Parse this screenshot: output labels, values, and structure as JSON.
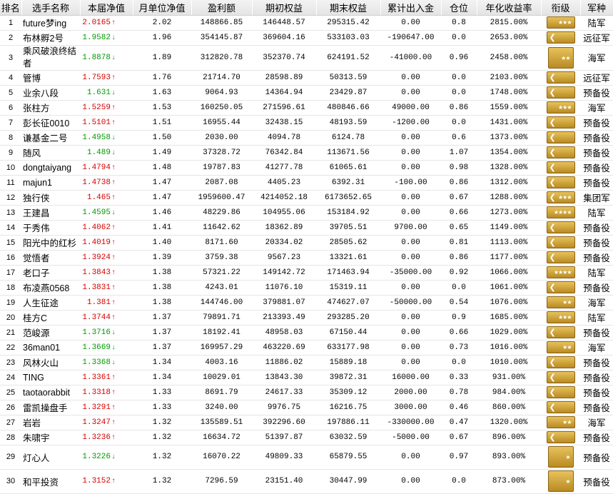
{
  "headers": [
    "排名",
    "选手名称",
    "本届净值",
    "月单位净值",
    "盈利额",
    "期初权益",
    "期末权益",
    "累计出入金",
    "仓位",
    "年化收益率",
    "衔级",
    "军种"
  ],
  "rows": [
    {
      "rank": "1",
      "name": "future梦ing",
      "nav": "2.0165",
      "dir": "up",
      "unit": "2.02",
      "profit": "148866.85",
      "begin": "146448.57",
      "end": "295315.42",
      "flow": "0.00",
      "pos": "0.8",
      "annual": "2815.00%",
      "badge": "stars3",
      "arm": "陆军"
    },
    {
      "rank": "2",
      "name": "布林孵2号",
      "nav": "1.9582",
      "dir": "down",
      "unit": "1.96",
      "profit": "354145.87",
      "begin": "369604.16",
      "end": "533103.03",
      "flow": "-190647.00",
      "pos": "0.0",
      "annual": "2653.00%",
      "badge": "chev",
      "arm": "远征军"
    },
    {
      "rank": "3",
      "name": "乘风破浪终结者",
      "nav": "1.8878",
      "dir": "down",
      "unit": "1.89",
      "profit": "312820.78",
      "begin": "352370.74",
      "end": "624191.52",
      "flow": "-41000.00",
      "pos": "0.96",
      "annual": "2458.00%",
      "badge": "tall2",
      "arm": "海军"
    },
    {
      "rank": "4",
      "name": "管博",
      "nav": "1.7593",
      "dir": "up",
      "unit": "1.76",
      "profit": "21714.70",
      "begin": "28598.89",
      "end": "50313.59",
      "flow": "0.00",
      "pos": "0.0",
      "annual": "2103.00%",
      "badge": "chev",
      "arm": "远征军"
    },
    {
      "rank": "5",
      "name": "业余八段",
      "nav": "1.631",
      "dir": "down",
      "unit": "1.63",
      "profit": "9064.93",
      "begin": "14364.94",
      "end": "23429.87",
      "flow": "0.00",
      "pos": "0.0",
      "annual": "1748.00%",
      "badge": "chev",
      "arm": "预备役"
    },
    {
      "rank": "6",
      "name": "张柱方",
      "nav": "1.5259",
      "dir": "up",
      "unit": "1.53",
      "profit": "160250.05",
      "begin": "271596.61",
      "end": "480846.66",
      "flow": "49000.00",
      "pos": "0.86",
      "annual": "1559.00%",
      "badge": "stars3",
      "arm": "海军"
    },
    {
      "rank": "7",
      "name": "彭长征0010",
      "nav": "1.5101",
      "dir": "up",
      "unit": "1.51",
      "profit": "16955.44",
      "begin": "32438.15",
      "end": "48193.59",
      "flow": "-1200.00",
      "pos": "0.0",
      "annual": "1431.00%",
      "badge": "chev",
      "arm": "预备役"
    },
    {
      "rank": "8",
      "name": "谦基金二号",
      "nav": "1.4958",
      "dir": "down",
      "unit": "1.50",
      "profit": "2030.00",
      "begin": "4094.78",
      "end": "6124.78",
      "flow": "0.00",
      "pos": "0.6",
      "annual": "1373.00%",
      "badge": "chev",
      "arm": "预备役"
    },
    {
      "rank": "9",
      "name": "随风",
      "nav": "1.489",
      "dir": "down",
      "unit": "1.49",
      "profit": "37328.72",
      "begin": "76342.84",
      "end": "113671.56",
      "flow": "0.00",
      "pos": "1.07",
      "annual": "1354.00%",
      "badge": "chev",
      "arm": "预备役"
    },
    {
      "rank": "10",
      "name": "dongtaiyang",
      "nav": "1.4794",
      "dir": "up",
      "unit": "1.48",
      "profit": "19787.83",
      "begin": "41277.78",
      "end": "61065.61",
      "flow": "0.00",
      "pos": "0.98",
      "annual": "1328.00%",
      "badge": "chev",
      "arm": "预备役"
    },
    {
      "rank": "11",
      "name": "majun1",
      "nav": "1.4738",
      "dir": "up",
      "unit": "1.47",
      "profit": "2087.08",
      "begin": "4405.23",
      "end": "6392.31",
      "flow": "-100.00",
      "pos": "0.86",
      "annual": "1312.00%",
      "badge": "chev",
      "arm": "预备役"
    },
    {
      "rank": "12",
      "name": "独行侠",
      "nav": "1.465",
      "dir": "up",
      "unit": "1.47",
      "profit": "1959600.47",
      "begin": "4214052.18",
      "end": "6173652.65",
      "flow": "0.00",
      "pos": "0.67",
      "annual": "1288.00%",
      "badge": "chev3",
      "arm": "集团军"
    },
    {
      "rank": "13",
      "name": "王建昌",
      "nav": "1.4595",
      "dir": "down",
      "unit": "1.46",
      "profit": "48229.86",
      "begin": "104955.06",
      "end": "153184.92",
      "flow": "0.00",
      "pos": "0.66",
      "annual": "1273.00%",
      "badge": "stars4",
      "arm": "陆军"
    },
    {
      "rank": "14",
      "name": "于秀伟",
      "nav": "1.4062",
      "dir": "up",
      "unit": "1.41",
      "profit": "11642.62",
      "begin": "18362.89",
      "end": "39705.51",
      "flow": "9700.00",
      "pos": "0.65",
      "annual": "1149.00%",
      "badge": "chev",
      "arm": "预备役"
    },
    {
      "rank": "15",
      "name": "阳光中的红杉",
      "nav": "1.4019",
      "dir": "up",
      "unit": "1.40",
      "profit": "8171.60",
      "begin": "20334.02",
      "end": "28505.62",
      "flow": "0.00",
      "pos": "0.81",
      "annual": "1113.00%",
      "badge": "chev",
      "arm": "预备役"
    },
    {
      "rank": "16",
      "name": "觉悟者",
      "nav": "1.3924",
      "dir": "up",
      "unit": "1.39",
      "profit": "3759.38",
      "begin": "9567.23",
      "end": "13321.61",
      "flow": "0.00",
      "pos": "0.86",
      "annual": "1177.00%",
      "badge": "chev",
      "arm": "预备役"
    },
    {
      "rank": "17",
      "name": "老口子",
      "nav": "1.3843",
      "dir": "up",
      "unit": "1.38",
      "profit": "57321.22",
      "begin": "149142.72",
      "end": "171463.94",
      "flow": "-35000.00",
      "pos": "0.92",
      "annual": "1066.00%",
      "badge": "stars4",
      "arm": "陆军"
    },
    {
      "rank": "18",
      "name": "布凌燕0568",
      "nav": "1.3831",
      "dir": "up",
      "unit": "1.38",
      "profit": "4243.01",
      "begin": "11076.10",
      "end": "15319.11",
      "flow": "0.00",
      "pos": "0.0",
      "annual": "1061.00%",
      "badge": "chev",
      "arm": "预备役"
    },
    {
      "rank": "19",
      "name": "人生征途",
      "nav": "1.381",
      "dir": "up",
      "unit": "1.38",
      "profit": "144746.00",
      "begin": "379881.07",
      "end": "474627.07",
      "flow": "-50000.00",
      "pos": "0.54",
      "annual": "1076.00%",
      "badge": "stars2",
      "arm": "海军"
    },
    {
      "rank": "20",
      "name": "桂方C",
      "nav": "1.3744",
      "dir": "up",
      "unit": "1.37",
      "profit": "79891.71",
      "begin": "213393.49",
      "end": "293285.20",
      "flow": "0.00",
      "pos": "0.9",
      "annual": "1685.00%",
      "badge": "stars3",
      "arm": "陆军"
    },
    {
      "rank": "21",
      "name": "范峻源",
      "nav": "1.3716",
      "dir": "down",
      "unit": "1.37",
      "profit": "18192.41",
      "begin": "48958.03",
      "end": "67150.44",
      "flow": "0.00",
      "pos": "0.66",
      "annual": "1029.00%",
      "badge": "chev",
      "arm": "预备役"
    },
    {
      "rank": "22",
      "name": "36man01",
      "nav": "1.3669",
      "dir": "down",
      "unit": "1.37",
      "profit": "169957.29",
      "begin": "463220.69",
      "end": "633177.98",
      "flow": "0.00",
      "pos": "0.73",
      "annual": "1016.00%",
      "badge": "stars2",
      "arm": "海军"
    },
    {
      "rank": "23",
      "name": "风林火山",
      "nav": "1.3368",
      "dir": "down",
      "unit": "1.34",
      "profit": "4003.16",
      "begin": "11886.02",
      "end": "15889.18",
      "flow": "0.00",
      "pos": "0.0",
      "annual": "1010.00%",
      "badge": "chev",
      "arm": "预备役"
    },
    {
      "rank": "24",
      "name": "TING",
      "nav": "1.3361",
      "dir": "up",
      "unit": "1.34",
      "profit": "10029.01",
      "begin": "13843.30",
      "end": "39872.31",
      "flow": "16000.00",
      "pos": "0.33",
      "annual": "931.00%",
      "badge": "chev",
      "arm": "预备役"
    },
    {
      "rank": "25",
      "name": "taotaorabbit",
      "nav": "1.3318",
      "dir": "up",
      "unit": "1.33",
      "profit": "8691.79",
      "begin": "24617.33",
      "end": "35309.12",
      "flow": "2000.00",
      "pos": "0.78",
      "annual": "984.00%",
      "badge": "chev",
      "arm": "预备役"
    },
    {
      "rank": "26",
      "name": "雷凯操盘手",
      "nav": "1.3291",
      "dir": "up",
      "unit": "1.33",
      "profit": "3240.00",
      "begin": "9976.75",
      "end": "16216.75",
      "flow": "3000.00",
      "pos": "0.46",
      "annual": "860.00%",
      "badge": "chev",
      "arm": "预备役"
    },
    {
      "rank": "27",
      "name": "岩岩",
      "nav": "1.3247",
      "dir": "up",
      "unit": "1.32",
      "profit": "135589.51",
      "begin": "392296.60",
      "end": "197886.11",
      "flow": "-330000.00",
      "pos": "0.47",
      "annual": "1320.00%",
      "badge": "stars2",
      "arm": "海军"
    },
    {
      "rank": "28",
      "name": "朱啸宇",
      "nav": "1.3236",
      "dir": "up",
      "unit": "1.32",
      "profit": "16634.72",
      "begin": "51397.87",
      "end": "63032.59",
      "flow": "-5000.00",
      "pos": "0.67",
      "annual": "896.00%",
      "badge": "chev",
      "arm": "预备役"
    },
    {
      "rank": "29",
      "name": "灯心人",
      "nav": "1.3226",
      "dir": "down",
      "unit": "1.32",
      "profit": "16070.22",
      "begin": "49809.33",
      "end": "65879.55",
      "flow": "0.00",
      "pos": "0.97",
      "annual": "893.00%",
      "badge": "tall1",
      "arm": "预备役"
    },
    {
      "rank": "30",
      "name": "和平投资",
      "nav": "1.3152",
      "dir": "up",
      "unit": "1.32",
      "profit": "7296.59",
      "begin": "23151.40",
      "end": "30447.99",
      "flow": "0.00",
      "pos": "0.0",
      "annual": "873.00%",
      "badge": "tall1",
      "arm": "预备役"
    }
  ],
  "colors": {
    "up": "#d40000",
    "down": "#009a00",
    "badge": "#d9a83a"
  },
  "icons": {
    "up": "arrow-up-icon",
    "down": "arrow-down-icon"
  }
}
